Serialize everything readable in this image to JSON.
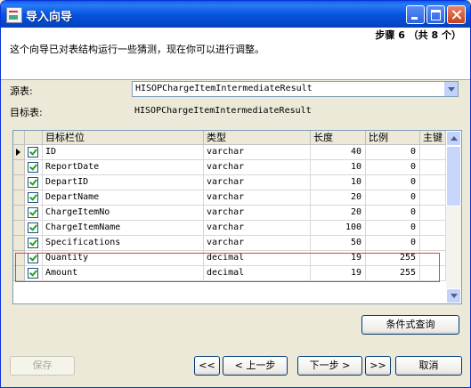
{
  "window": {
    "title": "导入向导"
  },
  "header": {
    "step": "步骤 6 （共 8 个）",
    "description": "这个向导已对表结构运行一些猜测，现在你可以进行调整。"
  },
  "source": {
    "label": "源表:",
    "value": "HISOPChargeItemIntermediateResult"
  },
  "target": {
    "label": "目标表:",
    "value": "HISOPChargeItemIntermediateResult"
  },
  "grid": {
    "columns": [
      "目标栏位",
      "类型",
      "长度",
      "比例",
      "主键"
    ],
    "rows": [
      {
        "checked": true,
        "name": "ID",
        "type": "varchar",
        "length": "40",
        "scale": "0",
        "current": true
      },
      {
        "checked": true,
        "name": "ReportDate",
        "type": "varchar",
        "length": "10",
        "scale": "0"
      },
      {
        "checked": true,
        "name": "DepartID",
        "type": "varchar",
        "length": "10",
        "scale": "0"
      },
      {
        "checked": true,
        "name": "DepartName",
        "type": "varchar",
        "length": "20",
        "scale": "0"
      },
      {
        "checked": true,
        "name": "ChargeItemNo",
        "type": "varchar",
        "length": "20",
        "scale": "0"
      },
      {
        "checked": true,
        "name": "ChargeItemName",
        "type": "varchar",
        "length": "100",
        "scale": "0"
      },
      {
        "checked": true,
        "name": "Specifications",
        "type": "varchar",
        "length": "50",
        "scale": "0"
      },
      {
        "checked": true,
        "name": "Quantity",
        "type": "decimal",
        "length": "19",
        "scale": "255"
      },
      {
        "checked": true,
        "name": "Amount",
        "type": "decimal",
        "length": "19",
        "scale": "255"
      }
    ]
  },
  "buttons": {
    "condition_query": "条件式查询",
    "save": "保存",
    "first": "<<",
    "prev": "< 上一步",
    "next": "下一步 >",
    "last": ">>",
    "cancel": "取消"
  },
  "colors": {
    "title_bar": "#0654e0",
    "highlight_border": "#e04040"
  }
}
